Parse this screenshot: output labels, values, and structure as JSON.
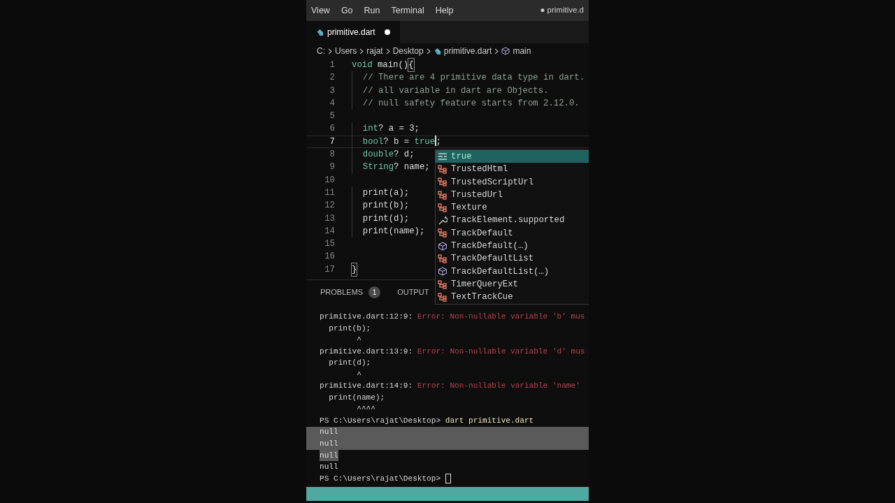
{
  "menu": [
    {
      "label": "View"
    },
    {
      "label": "Go"
    },
    {
      "label": "Run"
    },
    {
      "label": "Terminal"
    },
    {
      "label": "Help"
    }
  ],
  "window_title": "● primitive.d",
  "tab": {
    "label": "primitive.dart",
    "dirty": true
  },
  "breadcrumb": [
    {
      "label": "C:",
      "kind": "folder"
    },
    {
      "label": "Users",
      "kind": "folder"
    },
    {
      "label": "rajat",
      "kind": "folder"
    },
    {
      "label": "Desktop",
      "kind": "folder"
    },
    {
      "label": "primitive.dart",
      "kind": "file"
    },
    {
      "label": "main",
      "kind": "symbol"
    }
  ],
  "editor": {
    "lines": [
      {
        "number": "1",
        "current": false,
        "tokens": [
          {
            "text": "void",
            "kind": "keyword"
          },
          {
            "text": " main()",
            "kind": "plain"
          },
          {
            "text": "{",
            "kind": "bracket_match"
          }
        ]
      },
      {
        "number": "2",
        "current": false,
        "tokens": [
          {
            "text": "  // There are 4 primitive data type in dart.",
            "kind": "comment"
          }
        ]
      },
      {
        "number": "3",
        "current": false,
        "tokens": [
          {
            "text": "  // all variable in dart are Objects.",
            "kind": "comment"
          }
        ]
      },
      {
        "number": "4",
        "current": false,
        "tokens": [
          {
            "text": "  // null safety feature starts from 2.12.0.",
            "kind": "comment"
          }
        ]
      },
      {
        "number": "5",
        "current": false
      },
      {
        "number": "6",
        "current": false,
        "tokens": [
          {
            "text": "  int",
            "kind": "keyword"
          },
          {
            "text": "? a = 3;",
            "kind": "plain"
          }
        ]
      },
      {
        "number": "7",
        "current": true,
        "tokens": [
          {
            "text": "  bool",
            "kind": "keyword"
          },
          {
            "text": "? b = ",
            "kind": "plain"
          },
          {
            "text": "true",
            "kind": "keyword",
            "caret_after": true
          },
          {
            "text": ";",
            "kind": "plain"
          }
        ]
      },
      {
        "number": "8",
        "current": false,
        "tokens": [
          {
            "text": "  double",
            "kind": "keyword"
          },
          {
            "text": "? d;",
            "kind": "plain"
          }
        ]
      },
      {
        "number": "9",
        "current": false,
        "tokens": [
          {
            "text": "  String",
            "kind": "keyword"
          },
          {
            "text": "? name;",
            "kind": "plain"
          }
        ]
      },
      {
        "number": "10",
        "current": false
      },
      {
        "number": "11",
        "current": false,
        "tokens": [
          {
            "text": "  print(a);",
            "kind": "plain"
          }
        ]
      },
      {
        "number": "12",
        "current": false,
        "tokens": [
          {
            "text": "  print(b);",
            "kind": "plain"
          }
        ]
      },
      {
        "number": "13",
        "current": false,
        "tokens": [
          {
            "text": "  print(d);",
            "kind": "plain"
          }
        ]
      },
      {
        "number": "14",
        "current": false,
        "tokens": [
          {
            "text": "  print(name);",
            "kind": "plain"
          }
        ]
      },
      {
        "number": "15",
        "current": false
      },
      {
        "number": "16",
        "current": false
      },
      {
        "number": "17",
        "current": false,
        "tokens": [
          {
            "text": "}",
            "kind": "bracket_match"
          }
        ]
      }
    ]
  },
  "suggestions": [
    {
      "label": "true",
      "kind": "keyword",
      "selected": true
    },
    {
      "label": "TrustedHtml",
      "kind": "class",
      "selected": false
    },
    {
      "label": "TrustedScriptUrl",
      "kind": "class",
      "selected": false
    },
    {
      "label": "TrustedUrl",
      "kind": "class",
      "selected": false
    },
    {
      "label": "Texture",
      "kind": "class",
      "selected": false
    },
    {
      "label": "TrackElement.supported",
      "kind": "property",
      "selected": false
    },
    {
      "label": "TrackDefault",
      "kind": "class",
      "selected": false
    },
    {
      "label": "TrackDefault(…)",
      "kind": "constructor",
      "selected": false
    },
    {
      "label": "TrackDefaultList",
      "kind": "class",
      "selected": false
    },
    {
      "label": "TrackDefaultList(…)",
      "kind": "constructor",
      "selected": false
    },
    {
      "label": "TimerQueryExt",
      "kind": "class",
      "selected": false
    },
    {
      "label": "TextTrackCue",
      "kind": "class",
      "selected": false
    }
  ],
  "panel_tabs": [
    {
      "label": "PROBLEMS",
      "badge": "1",
      "selected": false
    },
    {
      "label": "OUTPUT",
      "selected": false
    }
  ],
  "terminal": {
    "lines": [
      {
        "kind": "error",
        "location": "primitive.dart:12:9: ",
        "message": "Error: Non-nullable variable 'b' mus"
      },
      {
        "kind": "plain",
        "text": "  print(b);"
      },
      {
        "kind": "plain",
        "text": "        ^"
      },
      {
        "kind": "error",
        "location": "primitive.dart:13:9: ",
        "message": "Error: Non-nullable variable 'd' mus"
      },
      {
        "kind": "plain",
        "text": "  print(d);"
      },
      {
        "kind": "plain",
        "text": "        ^"
      },
      {
        "kind": "error",
        "location": "primitive.dart:14:9: ",
        "message": "Error: Non-nullable variable 'name'"
      },
      {
        "kind": "plain",
        "text": "  print(name);"
      },
      {
        "kind": "plain",
        "text": "        ^^^^"
      },
      {
        "kind": "prompt",
        "prompt": "PS C:\\Users\\rajat\\Desktop> ",
        "command": "dart primitive.dart",
        "cursor": false
      },
      {
        "kind": "output",
        "text": "null",
        "selected": true,
        "full_line": true
      },
      {
        "kind": "output",
        "text": "null",
        "selected": true,
        "full_line": true
      },
      {
        "kind": "output",
        "text": "null",
        "selected": true,
        "full_line": false
      },
      {
        "kind": "output",
        "text": "null",
        "selected": false
      },
      {
        "kind": "prompt",
        "prompt": "PS C:\\Users\\rajat\\Desktop> ",
        "cursor": true
      }
    ]
  }
}
